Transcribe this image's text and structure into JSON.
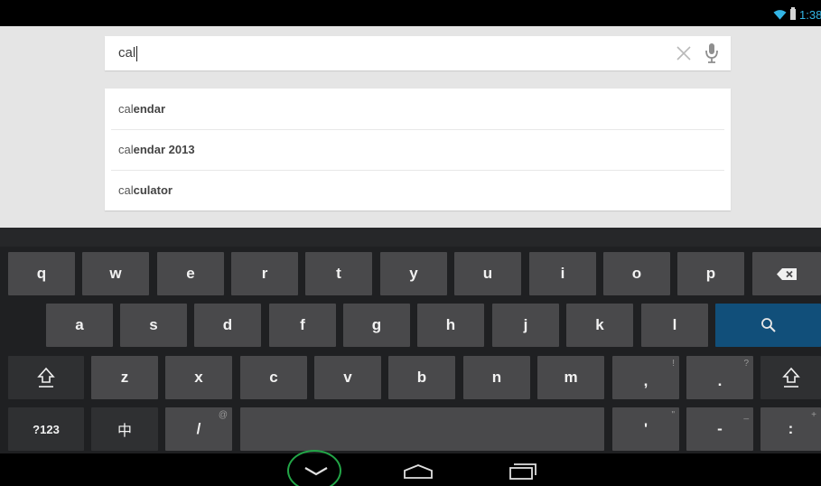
{
  "status_bar": {
    "time": "1:38"
  },
  "search": {
    "prefix": "ca",
    "typed": "l",
    "clear_icon": "close-icon",
    "mic_icon": "microphone-icon"
  },
  "suggestions": [
    {
      "prefix": "cal",
      "rest": "endar"
    },
    {
      "prefix": "cal",
      "rest": "endar 2013"
    },
    {
      "prefix": "cal",
      "rest": "culator"
    }
  ],
  "keyboard": {
    "row1": [
      "q",
      "w",
      "e",
      "r",
      "t",
      "y",
      "u",
      "i",
      "o",
      "p"
    ],
    "row2": [
      "a",
      "s",
      "d",
      "f",
      "g",
      "h",
      "j",
      "k",
      "l"
    ],
    "row3": [
      "z",
      "x",
      "c",
      "v",
      "b",
      "n",
      "m",
      ",",
      "."
    ],
    "row3_hints": [
      "",
      "",
      "",
      "",
      "",
      "",
      "",
      "!",
      "?"
    ],
    "symbols_label": "?123",
    "language_label": "中",
    "slash_label": "/",
    "slash_hint": "@",
    "apostrophe_label": "'",
    "apostrophe_hint": "\"",
    "dash_label": "-",
    "dash_hint": "_",
    "colon_label": ":",
    "colon_hint": "+",
    "accent_color": "#114f7a"
  },
  "nav": {
    "back_icon": "chevron-down-icon",
    "home_icon": "home-icon",
    "recents_icon": "recent-apps-icon",
    "highlight_color": "#22a547"
  }
}
